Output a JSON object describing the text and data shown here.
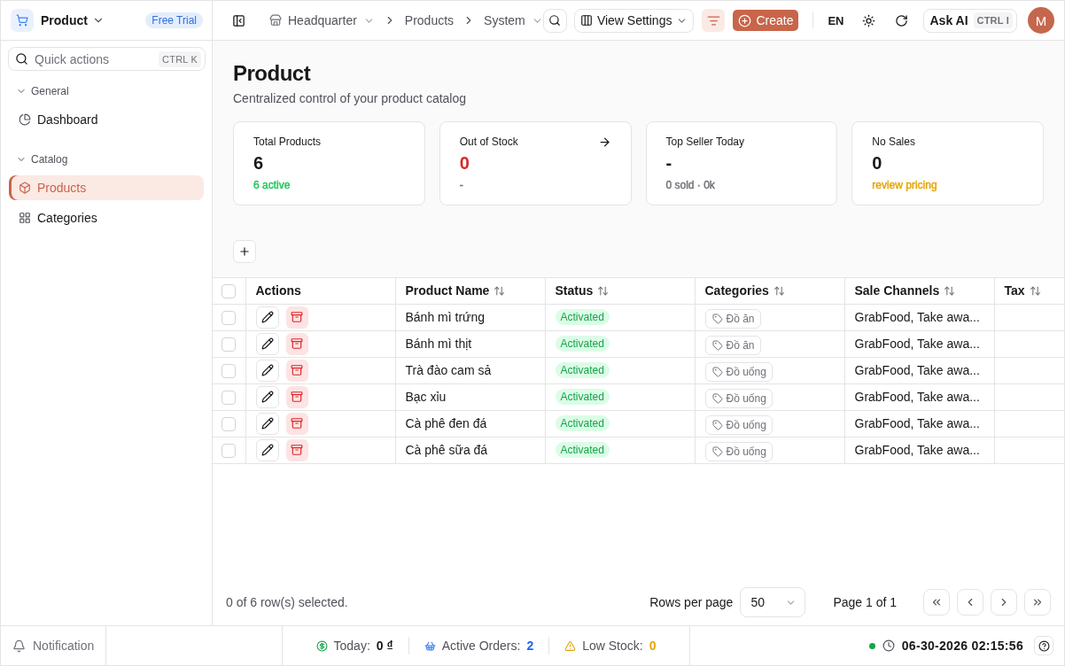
{
  "app": {
    "name": "Product",
    "badge": "Free Trial"
  },
  "sidebar": {
    "search": {
      "placeholder": "Quick actions",
      "shortcut": "CTRL K"
    },
    "sections": [
      {
        "title": "General",
        "expanded": true,
        "items": [
          {
            "label": "Dashboard",
            "selected": false
          }
        ]
      },
      {
        "title": "Catalog",
        "expanded": true,
        "items": [
          {
            "label": "Products",
            "selected": true
          },
          {
            "label": "Categories",
            "selected": false
          }
        ]
      }
    ]
  },
  "topbar": {
    "breadcrumbs": [
      {
        "label": "Headquarter",
        "dropdown": true
      },
      {
        "label": "Products",
        "dropdown": false
      },
      {
        "label": "System",
        "dropdown": true
      }
    ],
    "view_settings": "View Settings",
    "filter_active": true,
    "create": "Create",
    "language": "EN",
    "ask_ai": {
      "label": "Ask AI",
      "shortcut": "CTRL I"
    },
    "avatar": "M"
  },
  "page": {
    "title": "Product",
    "subtitle": "Centralized control of your product catalog"
  },
  "stats": [
    {
      "label": "Total Products",
      "value": {
        "text": "6",
        "color": "#18181b"
      },
      "note": {
        "text": "6 active",
        "color": "#22c55e"
      },
      "link": false
    },
    {
      "label": "Out of Stock",
      "value": {
        "text": "0",
        "color": "#dc2626"
      },
      "note": {
        "text": "-",
        "color": "#71717a"
      },
      "link": true
    },
    {
      "label": "Top Seller Today",
      "value": {
        "text": "-",
        "color": "#18181b"
      },
      "note": {
        "text": "0 sold · 0k",
        "color": "#71717a"
      },
      "link": false
    },
    {
      "label": "No Sales",
      "value": {
        "text": "0",
        "color": "#18181b"
      },
      "note": {
        "text": "review pricing",
        "color": "#e5a50a"
      },
      "link": false
    }
  ],
  "table": {
    "select_all": {
      "checked": false
    },
    "columns": [
      {
        "label": "Actions",
        "sortable": false
      },
      {
        "label": "Product Name",
        "sortable": true
      },
      {
        "label": "Status",
        "sortable": true
      },
      {
        "label": "Categories",
        "sortable": true
      },
      {
        "label": "Sale Channels",
        "sortable": true
      },
      {
        "label": "Tax",
        "sortable": true
      }
    ],
    "rows": [
      {
        "selected": false,
        "product_name": "Bánh mì trứng",
        "status": "Activated",
        "category": "Đồ ăn",
        "sale_channels": "GrabFood, Take awa..."
      },
      {
        "selected": false,
        "product_name": "Bánh mì thịt",
        "status": "Activated",
        "category": "Đồ ăn",
        "sale_channels": "GrabFood, Take awa..."
      },
      {
        "selected": false,
        "product_name": "Trà đào cam sả",
        "status": "Activated",
        "category": "Đồ uống",
        "sale_channels": "GrabFood, Take awa..."
      },
      {
        "selected": false,
        "product_name": "Bạc xỉu",
        "status": "Activated",
        "category": "Đồ uống",
        "sale_channels": "GrabFood, Take awa..."
      },
      {
        "selected": false,
        "product_name": "Cà phê đen đá",
        "status": "Activated",
        "category": "Đồ uống",
        "sale_channels": "GrabFood, Take awa..."
      },
      {
        "selected": false,
        "product_name": "Cà phê sữa đá",
        "status": "Activated",
        "category": "Đồ uống",
        "sale_channels": "GrabFood, Take awa..."
      }
    ]
  },
  "pagination": {
    "summary": "0 of 6 row(s) selected.",
    "rows_per_page_label": "Rows per page",
    "rows_per_page": "50",
    "page": "Page 1 of 1"
  },
  "footer": {
    "notification": "Notification",
    "stats": [
      {
        "kind": "revenue",
        "label": "Today:",
        "value": "0 ₫",
        "color": "#18181b"
      },
      {
        "kind": "orders",
        "label": "Active Orders:",
        "value": "2",
        "color": "#2563eb"
      },
      {
        "kind": "stock",
        "label": "Low Stock:",
        "value": "0",
        "color": "#e5a50a"
      }
    ],
    "online": true,
    "datetime": "06-30-2026 02:15:56"
  }
}
